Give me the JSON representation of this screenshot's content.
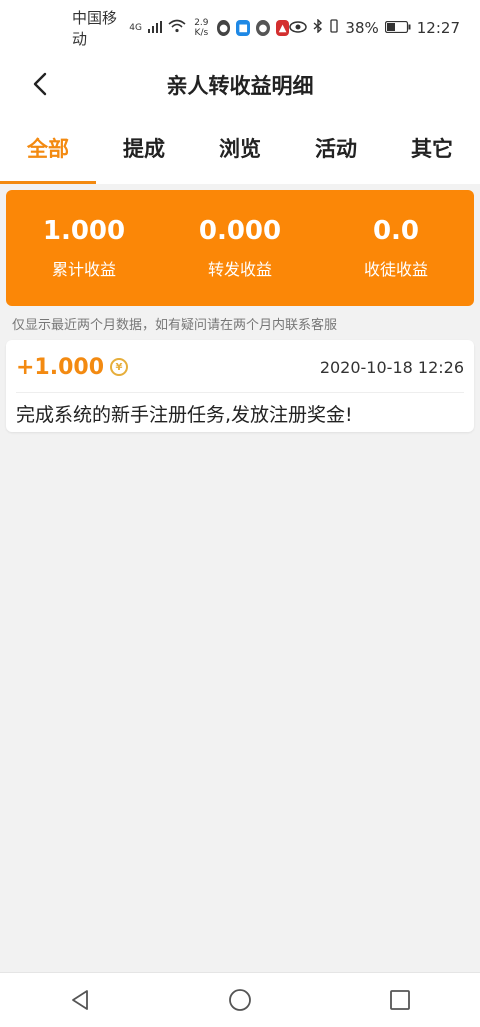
{
  "status_bar": {
    "carrier": "中国移动",
    "network": "4G",
    "net_speed_top": "2.9",
    "net_speed_bottom": "K/s",
    "battery": "38%",
    "time": "12:27"
  },
  "header": {
    "title": "亲人转收益明细"
  },
  "tabs": [
    {
      "label": "全部",
      "active": true
    },
    {
      "label": "提成",
      "active": false
    },
    {
      "label": "浏览",
      "active": false
    },
    {
      "label": "活动",
      "active": false
    },
    {
      "label": "其它",
      "active": false
    }
  ],
  "summary": {
    "items": [
      {
        "value": "1.000",
        "label": "累计收益"
      },
      {
        "value": "0.000",
        "label": "转发收益"
      },
      {
        "value": "0.0",
        "label": "收徒收益"
      }
    ]
  },
  "notice": "仅显示最近两个月数据，如有疑问请在两个月内联系客服",
  "records": [
    {
      "amount": "+1.000",
      "coin_symbol": "¥",
      "time": "2020-10-18 12:26",
      "description": "完成系统的新手注册任务,发放注册奖金!"
    }
  ],
  "colors": {
    "accent": "#f38a11",
    "summary_bg": "#fb8707",
    "coin": "#e6ae3b"
  }
}
